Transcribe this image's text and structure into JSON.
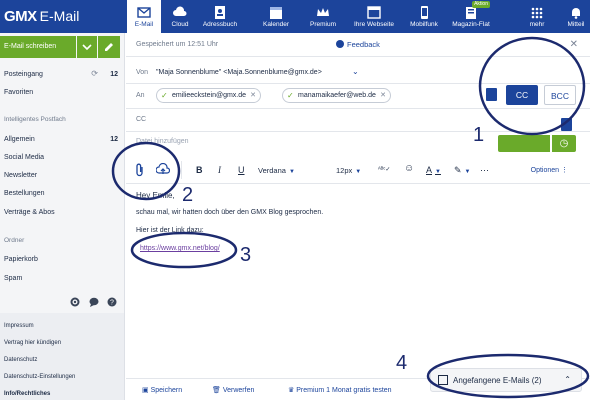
{
  "app": {
    "brand": "GMX",
    "product": "E-Mail"
  },
  "nav": [
    {
      "label": "E-Mail",
      "icon": "mail-icon"
    },
    {
      "label": "Cloud",
      "icon": "cloud-icon"
    },
    {
      "label": "Adressbuch",
      "icon": "addressbook-icon"
    },
    {
      "label": "Kalender",
      "icon": "calendar-icon",
      "day": "05"
    },
    {
      "label": "Premium",
      "icon": "crown-icon"
    },
    {
      "label": "Ihre Webseite",
      "icon": "website-icon"
    },
    {
      "label": "Mobilfunk",
      "icon": "mobile-icon"
    },
    {
      "label": "Magazin-Flat",
      "icon": "magazine-icon",
      "tag": "Aktion"
    },
    {
      "label": "mehr",
      "icon": "grid-icon"
    },
    {
      "label": "Mitteil",
      "icon": "bell-icon"
    }
  ],
  "sidebar": {
    "compose_label": "E-Mail schreiben",
    "folders": [
      {
        "label": "Posteingang",
        "count": "12"
      },
      {
        "label": "Favoriten"
      }
    ],
    "smart_heading": "Intelligentes Postfach",
    "smart": [
      {
        "label": "Allgemein",
        "count": "12"
      },
      {
        "label": "Social Media"
      },
      {
        "label": "Newsletter"
      },
      {
        "label": "Bestellungen"
      },
      {
        "label": "Verträge & Abos"
      }
    ],
    "folder_heading": "Ordner",
    "other": [
      {
        "label": "Papierkorb"
      },
      {
        "label": "Spam"
      }
    ],
    "footer_links": [
      "Impressum",
      "Vertrag hier kündigen",
      "Datenschutz",
      "Datenschutz-Einstellungen",
      "Info/Rechtliches"
    ]
  },
  "compose": {
    "saved_text": "Gespeichert um 12:51 Uhr",
    "feedback": "Feedback",
    "from_label": "Von",
    "from_value": "\"Maja Sonnenblume\" <Maja.Sonnenblume@gmx.de>",
    "to_label": "An",
    "recipients": [
      "emilieeckstein@gmx.de",
      "manamaikaefer@web.de"
    ],
    "cc_label": "CC",
    "cc_button": "CC",
    "bcc_button": "BCC",
    "attach_hint": "Datei hinzufügen",
    "font": "Verdana",
    "size": "12px",
    "options": "Optionen",
    "body": {
      "greeting": "Hey Emile,",
      "line1": "schau mal, wir hatten doch über den GMX Blog gesprochen.",
      "line2": "Hier ist der Link dazu:",
      "link": "https://www.gmx.net/blog/"
    },
    "bottom": {
      "save": "Speichern",
      "discard": "Verwerfen",
      "premium": "Premium 1 Monat gratis testen",
      "drafts": "Angefangene E-Mails (2)"
    }
  },
  "annotations": [
    "1",
    "2",
    "3",
    "4"
  ],
  "colors": {
    "brand": "#1c449b",
    "green": "#6aaa2a",
    "annotation": "#1c2a6e"
  }
}
